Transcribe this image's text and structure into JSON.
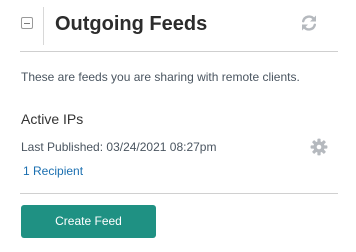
{
  "header": {
    "title": "Outgoing Feeds",
    "collapse_icon": "collapse-minus-icon",
    "refresh_icon": "refresh-icon"
  },
  "description": "These are feeds you are sharing with remote clients.",
  "feed": {
    "name": "Active IPs",
    "last_published": "Last Published: 03/24/2021 08:27pm",
    "recipients": "1 Recipient",
    "settings_icon": "gear-icon"
  },
  "actions": {
    "create_label": "Create Feed"
  },
  "colors": {
    "accent": "#1f9183",
    "link": "#1a6fb0",
    "icon": "#b5b9be"
  }
}
